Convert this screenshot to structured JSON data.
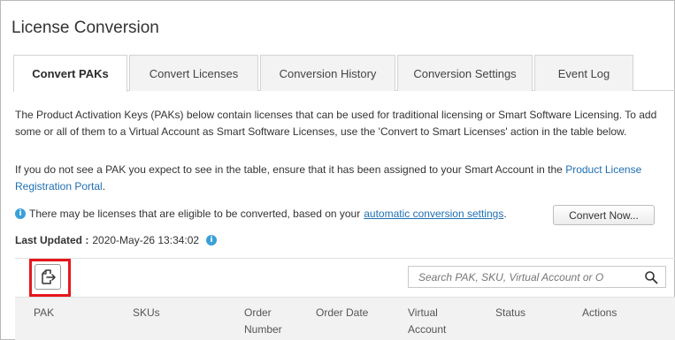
{
  "page": {
    "title": "License Conversion"
  },
  "tabs": [
    {
      "label": "Convert PAKs",
      "active": true
    },
    {
      "label": "Convert Licenses",
      "active": false
    },
    {
      "label": "Conversion History",
      "active": false
    },
    {
      "label": "Conversion Settings",
      "active": false
    },
    {
      "label": "Event Log",
      "active": false
    }
  ],
  "intro": {
    "paragraph1": "The Product Activation Keys (PAKs) below contain licenses that can be used for traditional licensing or Smart Software Licensing. To add some or all of them to a Virtual Account as Smart Software Licenses, use the 'Convert to Smart Licenses' action in the table below.",
    "paragraph2_prefix": "If you do not see a PAK you expect to see in the table, ensure that it has been assigned to your Smart Account in the",
    "paragraph2_link": "Product License Registration Portal",
    "paragraph2_suffix": "."
  },
  "notice": {
    "text": "There may be licenses that are eligible to be converted, based on your",
    "link": "automatic conversion settings",
    "suffix": ".",
    "button": "Convert Now..."
  },
  "last_updated": {
    "label": "Last Updated :",
    "value": "2020-May-26 13:34:02"
  },
  "search": {
    "placeholder": "Search PAK, SKU, Virtual Account or O"
  },
  "table": {
    "columns": [
      "PAK",
      "SKUs",
      "Order Number",
      "Order Date",
      "Virtual Account",
      "Status",
      "Actions"
    ]
  },
  "colors": {
    "link": "#1f6fb2",
    "info": "#3aa0d8",
    "highlight": "#e5171b",
    "header_bg": "#f2f2f2",
    "tab_bg": "#f3f3f3"
  },
  "icons": {
    "export": "export-icon",
    "search": "search-icon",
    "info": "info-icon"
  }
}
